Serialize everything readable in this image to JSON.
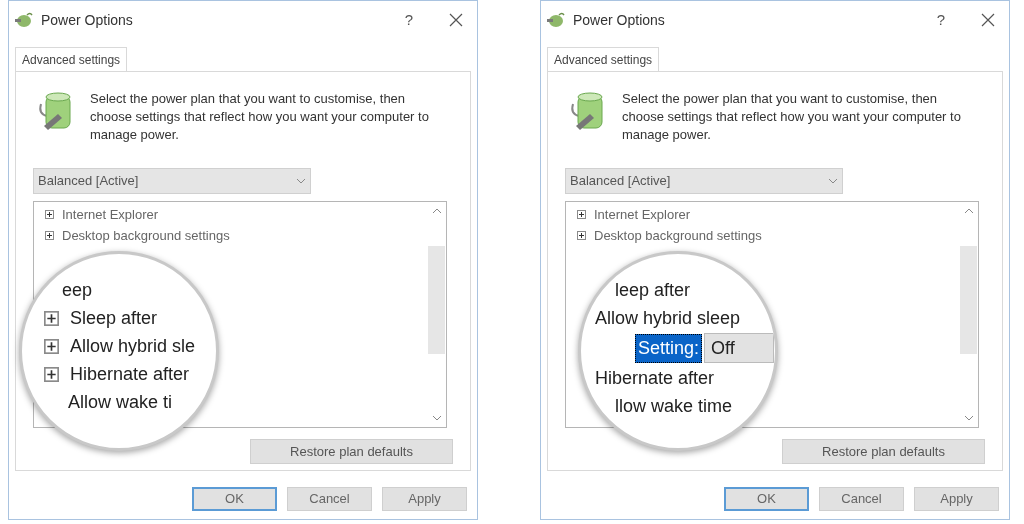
{
  "dialogs": [
    {
      "title": "Power Options",
      "help": "?",
      "tab": {
        "label": "Advanced settings",
        "selected": true
      },
      "description": "Select the power plan that you want to customise, then choose settings that reflect how you want your computer to manage power.",
      "plan": {
        "value": "Balanced [Active]"
      },
      "list_items": [
        {
          "label": "Internet Explorer",
          "expanded": false
        },
        {
          "label": "Desktop background settings",
          "expanded": false
        }
      ],
      "magnifier": [
        {
          "kind": "plain",
          "label": "eep"
        },
        {
          "kind": "collapsed",
          "label": "Sleep after"
        },
        {
          "kind": "collapsed",
          "label": "Allow hybrid sle"
        },
        {
          "kind": "collapsed",
          "label": "Hibernate after"
        },
        {
          "kind": "plain",
          "label": "Allow wake ti"
        }
      ],
      "restore_button": "Restore plan defaults",
      "buttons": [
        {
          "label": "OK",
          "default": true
        },
        {
          "label": "Cancel",
          "default": false
        },
        {
          "label": "Apply",
          "default": false
        }
      ]
    },
    {
      "title": "Power Options",
      "help": "?",
      "tab": {
        "label": "Advanced settings",
        "selected": true
      },
      "description": "Select the power plan that you want to customise, then choose settings that reflect how you want your computer to manage power.",
      "plan": {
        "value": "Balanced [Active]"
      },
      "list_items": [
        {
          "label": "Internet Explorer",
          "expanded": false
        },
        {
          "label": "Desktop background settings",
          "expanded": false
        }
      ],
      "magnifier": [
        {
          "kind": "plain",
          "label": "leep after"
        },
        {
          "kind": "plain",
          "label": "Allow hybrid sleep"
        },
        {
          "kind": "setting",
          "label": "Setting:",
          "value": "Off"
        },
        {
          "kind": "plain",
          "label": "Hibernate after"
        },
        {
          "kind": "plain",
          "label": "llow wake time"
        }
      ],
      "restore_button": "Restore plan defaults",
      "buttons": [
        {
          "label": "OK",
          "default": true
        },
        {
          "label": "Cancel",
          "default": false
        },
        {
          "label": "Apply",
          "default": false
        }
      ]
    }
  ]
}
